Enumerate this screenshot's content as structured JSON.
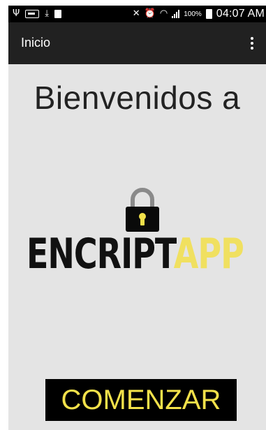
{
  "status_bar": {
    "icons": [
      "usb-icon",
      "voicemail-icon",
      "download-icon",
      "battery-100-notification-icon",
      "mute-icon",
      "alarm-icon",
      "wifi-icon",
      "signal-icon",
      "battery-icon"
    ],
    "battery_percent": "100%",
    "time": "04:07 AM",
    "small_badge": "100"
  },
  "app_bar": {
    "title": "Inicio",
    "menu_icon": "more-vert-icon"
  },
  "main": {
    "welcome_text": "Bienvenidos a",
    "logo": {
      "part_dark": "ENCRIPT",
      "part_yellow": "APP",
      "icon": "padlock-icon"
    },
    "start_button_label": "COMENZAR"
  },
  "colors": {
    "status_bar_bg": "#000000",
    "app_bar_bg": "#212121",
    "screen_bg": "#e4e4e4",
    "accent_yellow": "#f2e14a",
    "button_bg": "#000000"
  }
}
